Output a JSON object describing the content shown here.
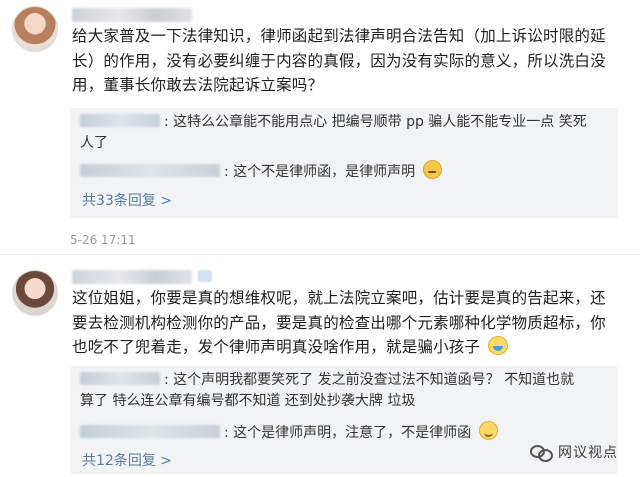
{
  "comments": [
    {
      "body": [
        "给大家普及一下法律知识，律师函起到法律声明合法告知（加上诉讼时限的延",
        "长）的作用，没有必要纠缠于内容的真假，因为没有实际的意义，所以洗白没",
        "用，董事长你敢去法院起诉立案吗？"
      ],
      "replies": [
        {
          "line1": "这特么公章能不能用点心 把编号顺带 pp 骗人能不能专业一点 笑死",
          "line2": "人了"
        },
        {
          "line1": "这个不是律师函，是律师声明",
          "emoji": "smirk-emoji"
        }
      ],
      "more_replies": "共33条回复 >",
      "time": "5-26 17:11"
    },
    {
      "body": [
        "这位姐姐，你要是真的想维权呢，就上法院立案吧，估计要是真的告起来，还",
        "要去检测机构检测你的产品，要是真的检查出哪个元素哪种化学物质超标，你",
        "也吃不了兜着走，发个律师声明真没啥作用，就是骗小孩子"
      ],
      "body_emoji": "laugh-emoji",
      "replies": [
        {
          "line1": "这个声明我都要笑死了 发之前没查过法不知道函号？ 不知道也就",
          "line2": "算了 特么连公章有编号都不知道 还到处抄袭大牌 垃圾"
        },
        {
          "line1": "这个是律师声明，注意了，不是律师函",
          "emoji": "smile-emoji"
        }
      ],
      "more_replies": "共12条回复 >"
    }
  ],
  "watermark": {
    "text": "网议视点",
    "icon": "wechat-logo-icon"
  }
}
